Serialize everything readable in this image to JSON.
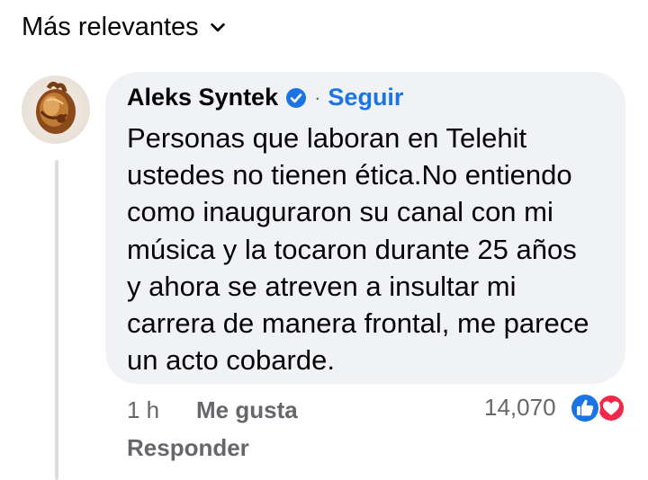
{
  "sort": {
    "label": "Más relevantes",
    "icon": "chevron-down-icon"
  },
  "comment": {
    "author": "Aleks Syntek",
    "verified_icon": "verified-badge-icon",
    "separator": "·",
    "follow_label": "Seguir",
    "text": "Personas que laboran en Telehit\nustedes no tienen ética.No entiendo\ncomo inauguraron su canal con mi\nmúsica y la tocaron durante 25 años\ny ahora se atreven a insultar mi\ncarrera de manera frontal, me parece\nun acto cobarde.",
    "time": "1 h",
    "like_label": "Me gusta",
    "reply_label": "Responder",
    "reaction_count": "14,070",
    "reactions": [
      "like-reaction-icon",
      "love-reaction-icon"
    ]
  },
  "colors": {
    "bubble": "#f0f2f5",
    "accent": "#1b74e4",
    "secondary_text": "#65676b",
    "love": "#f02849"
  }
}
